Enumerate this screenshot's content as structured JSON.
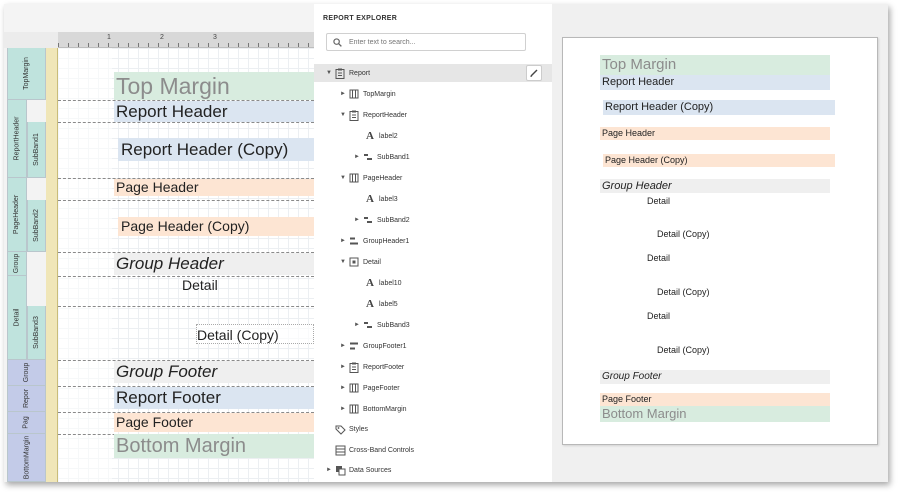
{
  "designer": {
    "ruler_numbers": [
      "1",
      "2",
      "3"
    ],
    "band_labels": {
      "top_margin": "TopMargin",
      "report_header": "ReportHeader",
      "subband1": "SubBand1",
      "page_header": "PageHeader",
      "subband2": "SubBand2",
      "group": "Group",
      "detail": "Detail",
      "subband3": "SubBand3",
      "group_footer": "Group",
      "report_footer": "Repor",
      "page_footer": "Pag",
      "bottom_margin": "BottomMargin"
    },
    "controls": {
      "top_margin": "Top Margin",
      "report_header": "Report Header",
      "report_header_copy": "Report Header (Copy)",
      "page_header": "Page Header",
      "page_header_copy": "Page Header (Copy)",
      "group_header": "Group Header",
      "detail": "Detail",
      "detail_copy": "Detail (Copy)",
      "group_footer": "Group Footer",
      "report_footer": "Report Footer",
      "page_footer": "Page Footer",
      "bottom_margin": "Bottom Margin"
    }
  },
  "explorer": {
    "title": "REPORT EXPLORER",
    "search_placeholder": "Enter text to search...",
    "tree": {
      "report": "Report",
      "top_margin": "TopMargin",
      "report_header": "ReportHeader",
      "label2": "label2",
      "subband1": "SubBand1",
      "page_header": "PageHeader",
      "label3": "label3",
      "subband2": "SubBand2",
      "group_header1": "GroupHeader1",
      "detail": "Detail",
      "label10": "label10",
      "label5": "label5",
      "subband3": "SubBand3",
      "group_footer1": "GroupFooter1",
      "report_footer": "ReportFooter",
      "page_footer": "PageFooter",
      "bottom_margin": "BottomMargin",
      "styles": "Styles",
      "cross_band": "Cross-Band Controls",
      "data_sources": "Data Sources"
    }
  },
  "preview": {
    "top_margin": "Top Margin",
    "report_header": "Report Header",
    "report_header_copy": "Report Header (Copy)",
    "page_header": "Page Header",
    "page_header_copy": "Page Header (Copy)",
    "group_header": "Group Header",
    "detail": "Detail",
    "detail_copy": "Detail (Copy)",
    "group_footer": "Group Footer",
    "page_footer": "Page Footer",
    "bottom_margin": "Bottom Margin"
  },
  "colors": {
    "margin_band": "#d8ecdf",
    "header_band": "#dbe5f1",
    "page_header_band": "#fde5d3",
    "group_band": "#efefef",
    "footer_band": "#dbe5f1"
  }
}
